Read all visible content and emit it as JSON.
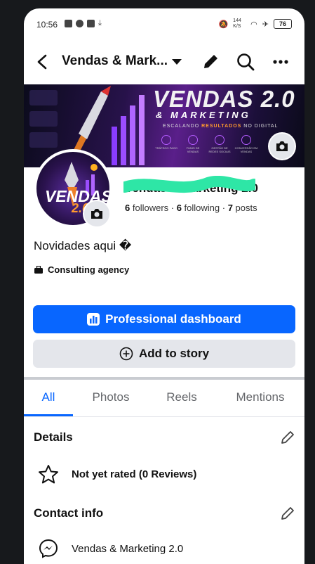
{
  "status_bar": {
    "time": "10:56",
    "net_speed": "144 K/S",
    "battery": "76"
  },
  "header": {
    "page_name": "Vendas & Mark..."
  },
  "cover": {
    "title": "VENDAS 2.0",
    "subtitle": "& MARKETING",
    "tagline_pre": "ESCALANDO ",
    "tagline_highlight": "RESULTADOS",
    "tagline_post": " NO DIGITAL",
    "categories": [
      "TRÁFEGO PAGO",
      "FUNIS DE VENDAS",
      "GESTÃO DE REDES SOCIAIS",
      "CONVERSÃO EM VENDAS"
    ]
  },
  "avatar": {
    "text": "VENDAS",
    "number": "2.0"
  },
  "profile": {
    "name": "Vendas & Marketing 2.0",
    "followers_count": "6",
    "followers_label": " followers · ",
    "following_count": "6",
    "following_label": " following · ",
    "posts_count": "7",
    "posts_label": " posts",
    "bio": "Novidades aqui �",
    "category": "Consulting agency"
  },
  "buttons": {
    "dashboard": "Professional dashboard",
    "add_story": "Add to story"
  },
  "tabs": [
    {
      "label": "All",
      "active": true
    },
    {
      "label": "Photos"
    },
    {
      "label": "Reels"
    },
    {
      "label": "Mentions"
    }
  ],
  "details": {
    "title": "Details",
    "rating": "Not yet rated (0 Reviews)"
  },
  "contact": {
    "title": "Contact info",
    "messenger": "Vendas & Marketing 2.0"
  },
  "colors": {
    "accent": "#0866ff",
    "redaction": "#2ee6a6"
  }
}
